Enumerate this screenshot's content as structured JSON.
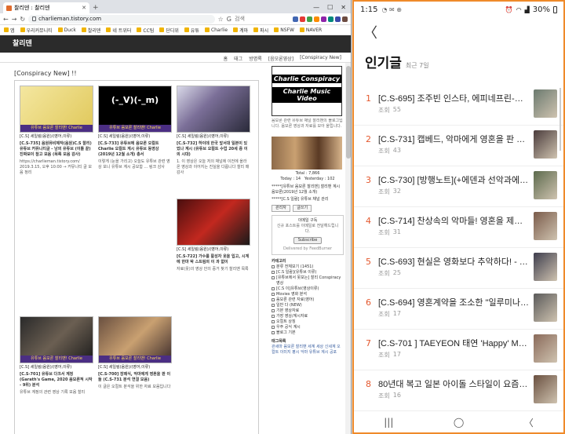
{
  "browser": {
    "tab_title": "찰리덴 : 찰리덴",
    "url": "charlieman.tistory.com",
    "search_placeholder": "검색",
    "bookmarks": [
      "앱",
      "우리커뮤니티",
      "Duck",
      "찰리덴",
      "네 트위터",
      "CC팀",
      "단디위",
      "유튜",
      "Charlie",
      "계마",
      "파시",
      "NSFW",
      "NAVER"
    ]
  },
  "site": {
    "name": "찰리덴",
    "menu": [
      "홈",
      "태그",
      "방명록",
      "[음모론영상]",
      "[Conspiracy New]"
    ],
    "page_title": "[Conspiracy New] !!",
    "posts": [
      {
        "category": "[C.S] 세일링(음원)/(영어,이류)",
        "title": "[C.S-735] 음원뮤비제작(음원)C.S 찰리) 유튜브 커뮤니티글 - 남의 유튜브 (이틀 끝) 진짜보이 참고 모음 (목록 모음 감사)",
        "text": "https://charlieman.tistory.com/ 2019.3.15, 오후 10:00 → 커뮤니티 글 모음 정리",
        "badge": "유튜브 음모론 찰리맨! Charlie Conspiracy"
      },
      {
        "category": "[C.S] 세일링(음원)/(영어,이류)",
        "title": "[C.S-733] 유튜브에 음모론 오컬트 Charlie 오컬트 계시 유튜브 동영상 (2019년 12월 소개) 총서",
        "text": "이렇게 (눈을 가리고) 오늘도 유튜브 관련 영상 보니 유튜브 계시 공모함 ... 링크 감사",
        "badge": "유튜브 음모론 찰리맨! Charlie Conspiracy"
      },
      {
        "category": "[C.S] 세일링(음원)/(영어,이류)",
        "title": "[C.S-732] 하이데 한국 앞서대 일본이 있었나 계시 (유튜브 오컬트 수업 20세 중 이의 시대)",
        "text": "1. 이 영상은 오늘 저의 채널에 이전에 올라온 영상과 이어지는 진실을 다룹니다 찰리 매 감사",
        "badge": ""
      },
      {
        "category": "[C.S] 세일링(음원)/(영어,이류)",
        "title": "[C.S-722] 가수를 활성자 옷을 입고, 시계에 한마 박 스트림의 이 과 없이",
        "text": "자료(옷)의 영상 안의 증거 찾기 찰리맨 목록",
        "badge": ""
      },
      {
        "category": "[C.S] 세일링(음원)/(영어,이류)",
        "title": "[C.S-701] 유튜브 다크서 계정(Garath's Game, 2020 음모론적 시작 - 9위) 분석",
        "text": "유튜브 계정의 관련 영상 기록 모음 찰리",
        "badge": "유튜브 음모론 찰리맨! Charlie Conspiracy"
      },
      {
        "category": "[C.S] 세일링(음원)/(영어,이류)",
        "title": "[C.S-700] 장례식, 악마에게 영혼을 판 이들 (C.S-731 분석 연결 모음)",
        "text": "이 글은 오컬트 분석을 위한 자료 모음입니다",
        "badge": "유튜브 음모론 찰리맨! Charlie Conspiracy"
      }
    ],
    "sidebar": {
      "banner_line1": "Charlie Conspiracy",
      "banner_line2": "Charlie Music Video",
      "intro": "음모론 관련 유튜브 채널 찰리맨의 블로그입니다. 음모론 영상과 자료를 모아 올립니다.",
      "total": "Total : 7,866",
      "today": "Today : 14",
      "yesterday": "Yesterday : 102",
      "note1": "*****[유튜브 음모론 찰리맨] 찰리맨 계시 음모론(2019년 12월 소개)",
      "note2": "*****[C.S 일람] 유튜브 채널 관리",
      "btn_manage": "관리자",
      "btn_write": "글쓰기",
      "subscribe_title": "이메일 구독",
      "subscribe_text": "신규 포스트를 이메일로 전달해드립니다.",
      "subscribe_btn": "Subscribe",
      "delivered": "Delivered by FeedBurner",
      "category_title": "카테고리",
      "categories": [
        "분류 전체보기 (1451)",
        "[C.S 일람](유튜브 이류)",
        "[유튜브에서 못보는] 찰리 Conspiracy 영상",
        "[C.S 이]유튜브(영상이류)",
        "Movies 영화 분석",
        "음모론 관련 자료(영어)",
        "일반 다 (NEW)",
        "기본 영상자료",
        "가장 영상/계시자료",
        "오컬트 상징",
        "우주 공식 계시",
        "블로그 기본"
      ],
      "tag_title": "태그목록",
      "tags": "관세마 음모론 찰리맨 세계 세상 신세계 오컬트 이미지 평시 악마 유튜브 계시 공포"
    }
  },
  "phone": {
    "status_time": "1:15",
    "battery": "30%",
    "heading": "인기글",
    "heading_sub": "최근 7일",
    "views_label": "조회",
    "items": [
      {
        "rank": "1",
        "title": "[C.S-695] 조주빈 인스타, 에피네프린-아드...",
        "views": "55",
        "color": "#6b7a6f"
      },
      {
        "rank": "2",
        "title": "[C.S-731] 캡베드, 악마에게 영혼을 판 이들...",
        "views": "43",
        "color": "#4a3b3b"
      },
      {
        "rank": "3",
        "title": "[C.S-730] [방행노트](+에덴과 선악과에 대한...",
        "views": "32",
        "color": "#5c6a4d"
      },
      {
        "rank": "4",
        "title": "[C.S-714] 찬상속의 악마들! 영혼을 제물로...",
        "views": "31",
        "color": "#7a5b4a"
      },
      {
        "rank": "5",
        "title": "[C.S-693] 현실은 영화보다 추악하다! - 블랙...",
        "views": "25",
        "color": "#3d3d4d"
      },
      {
        "rank": "6",
        "title": "[C.S-694] 영혼계약을 조소한 \"일루미나티\"...",
        "views": "17",
        "color": "#5a5a5a"
      },
      {
        "rank": "7",
        "title": "[C.S-701 ] TAEYEON 태연 'Happy' MV 해...",
        "views": "17",
        "color": "#8a6a5a"
      },
      {
        "rank": "8",
        "title": "80년대 복고 일본 아이돌 스타일이 요즘 문득...",
        "views": "16",
        "color": "#6a5040"
      }
    ]
  }
}
